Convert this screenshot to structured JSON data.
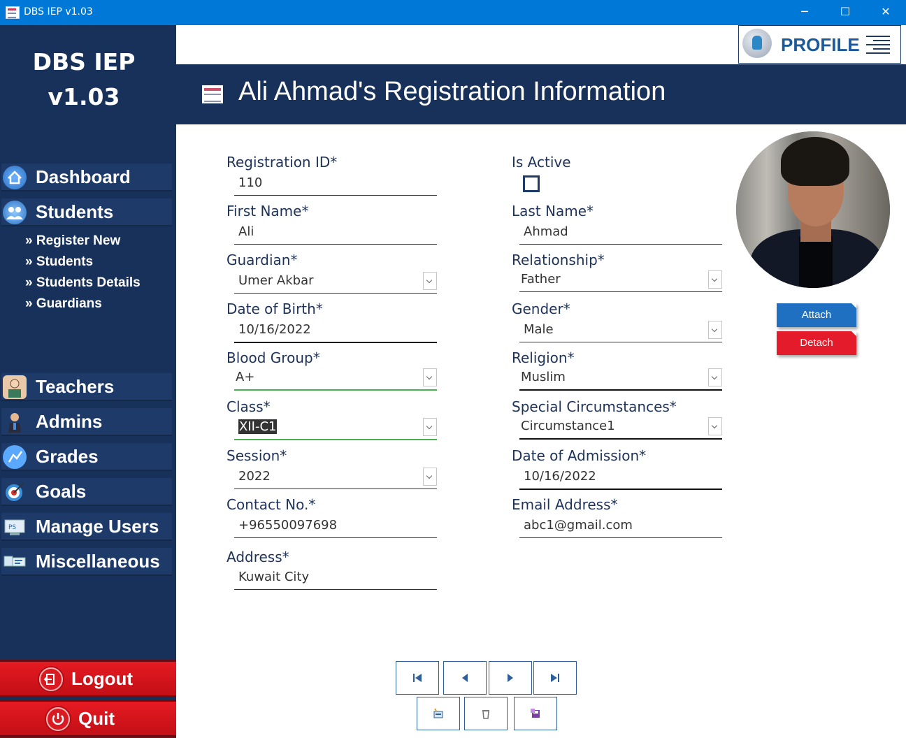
{
  "window": {
    "title": "DBS IEP v1.03",
    "minimize": "─",
    "maximize": "☐",
    "close": "✕"
  },
  "sidebar": {
    "brand_line1": "DBS IEP",
    "brand_line2": "v1.03",
    "nav": [
      {
        "label": "Dashboard",
        "icon": "home-icon"
      },
      {
        "label": "Students",
        "icon": "students-icon"
      },
      {
        "label": "Teachers",
        "icon": "teacher-icon"
      },
      {
        "label": "Admins",
        "icon": "admin-icon"
      },
      {
        "label": "Grades",
        "icon": "grades-icon"
      },
      {
        "label": "Goals",
        "icon": "target-icon"
      },
      {
        "label": "Manage Users",
        "icon": "manage-users-icon"
      },
      {
        "label": "Miscellaneous",
        "icon": "misc-icon"
      }
    ],
    "sub_items": [
      "» Register New",
      "» Students",
      "» Students Details",
      "» Guardians"
    ],
    "logout": "Logout",
    "quit": "Quit"
  },
  "profile": {
    "label": "PROFILE"
  },
  "header": {
    "title": "Ali Ahmad's Registration Information"
  },
  "form": {
    "registration_id": {
      "label": "Registration ID*",
      "value": "110"
    },
    "is_active": {
      "label": "Is Active",
      "checked": false
    },
    "first_name": {
      "label": "First Name*",
      "value": "Ali"
    },
    "last_name": {
      "label": "Last Name*",
      "value": "Ahmad"
    },
    "guardian": {
      "label": "Guardian*",
      "value": "Umer Akbar"
    },
    "relationship": {
      "label": "Relationship*",
      "value": "Father"
    },
    "dob": {
      "label": "Date of Birth*",
      "value": "10/16/2022"
    },
    "gender": {
      "label": "Gender*",
      "value": "Male"
    },
    "blood_group": {
      "label": "Blood Group*",
      "value": "A+"
    },
    "religion": {
      "label": "Religion*",
      "value": "Muslim"
    },
    "class": {
      "label": "Class*",
      "value": "XII-C1"
    },
    "special": {
      "label": "Special Circumstances*",
      "value": "Circumstance1"
    },
    "session": {
      "label": "Session*",
      "value": "2022"
    },
    "admission": {
      "label": "Date of Admission*",
      "value": "10/16/2022"
    },
    "contact": {
      "label": "Contact No.*",
      "value": "+96550097698"
    },
    "email": {
      "label": "Email Address*",
      "value": "abc1@gmail.com"
    },
    "address": {
      "label": "Address*",
      "value": "Kuwait City"
    }
  },
  "photo_actions": {
    "attach": "Attach",
    "detach": "Detach"
  },
  "colors": {
    "sidebar": "#18315a",
    "accent": "#0078d7",
    "danger": "#e31b2a",
    "attach": "#1f70c0"
  }
}
